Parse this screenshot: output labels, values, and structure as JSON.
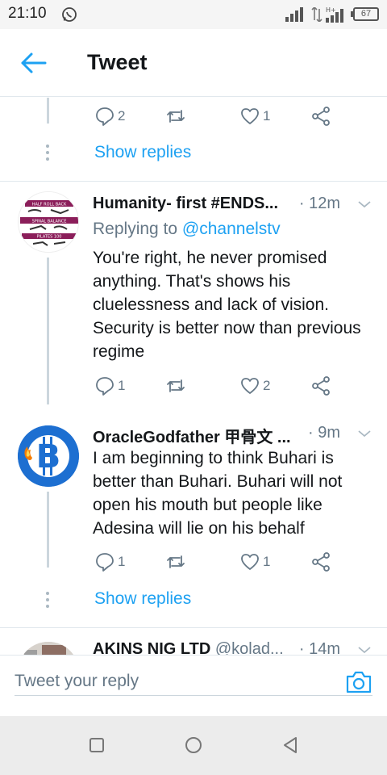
{
  "status_bar": {
    "time": "21:10",
    "battery": "67"
  },
  "header": {
    "title": "Tweet"
  },
  "thread_top": {
    "actions": {
      "replies": "2",
      "likes": "1"
    },
    "show_replies": "Show replies"
  },
  "tweets": [
    {
      "author": "Humanity- first #ENDS...",
      "time": "· 12m",
      "replying_label": "Replying to ",
      "replying_to": "@channelstv",
      "text": "You're right, he never promised anything. That's shows his cluelessness and lack of vision. Security is better now than previous regime",
      "replies": "1",
      "likes": "2",
      "avatar_lines": [
        "HALF ROLL BACK",
        "SPINAL BALANCE",
        "PILATES 100"
      ]
    },
    {
      "author": "OracleGodfather 甲骨文 ...",
      "time": "· 9m",
      "text": "I am beginning to think Buhari is better than Buhari. Buhari will not open his mouth but people like Adesina will lie on his behalf",
      "replies": "1",
      "likes": "1",
      "show_replies": "Show replies"
    },
    {
      "author": "AKINS NIG LTD",
      "handle": "@kolad...",
      "time": "· 14m"
    }
  ],
  "reply_bar": {
    "placeholder": "Tweet your reply"
  },
  "colors": {
    "accent": "#1da1f2",
    "secondary_text": "#657786",
    "thread_line": "#ccd6dd",
    "divider": "#e1e8ed"
  },
  "icons": {
    "back": "arrow-left-icon",
    "reply": "reply-bubble-icon",
    "retweet": "retweet-icon",
    "like": "heart-icon",
    "share": "share-icon",
    "caret": "chevron-down-icon",
    "camera": "camera-icon"
  }
}
